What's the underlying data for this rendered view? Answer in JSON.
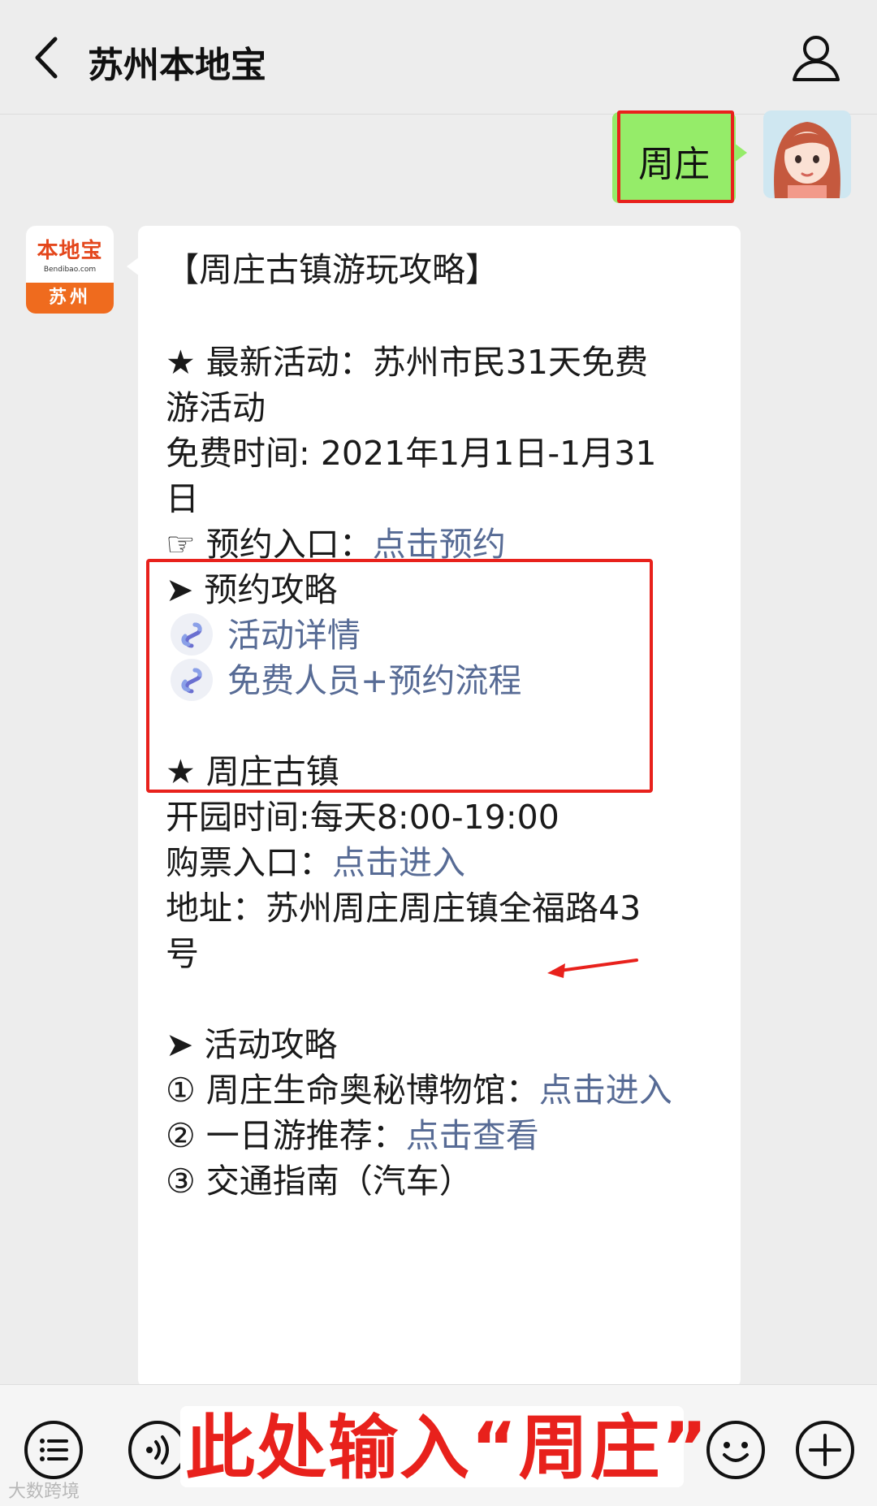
{
  "header": {
    "title": "苏州本地宝"
  },
  "outgoing": {
    "text": "周庄"
  },
  "bot": {
    "avatar_brand": "本地宝",
    "avatar_domain": "Bendibao.com",
    "avatar_city": "苏州"
  },
  "message": {
    "title": "【周庄古镇游玩攻略】",
    "s1_heading": "★ 最新活动：苏州市民31天免费",
    "s1_heading_cont": "游活动",
    "s1_time": "免费时间: 2021年1月1日-1月31",
    "s1_time_cont": "日",
    "reserve_label": "☞ 预约入口：",
    "reserve_link": "点击预约",
    "guide_heading": "➤ 预约攻略",
    "mp_link_1": "活动详情",
    "mp_link_2": "免费人员+预约流程",
    "s2_heading": "★ 周庄古镇",
    "s2_hours": "开园时间:每天8:00-19:00",
    "ticket_label": "购票入口：",
    "ticket_link": "点击进入",
    "address": "地址：苏州周庄周庄镇全福路43",
    "address_cont": "号",
    "s3_heading": "➤ 活动攻略",
    "item1_label": "① 周庄生命奥秘博物馆：",
    "item1_link": "点击进入",
    "item2_label": "② 一日游推荐：",
    "item2_link": "点击查看",
    "item3_label": "③ 交通指南（汽车）"
  },
  "annotation": {
    "overlay_text": "此处输入“周庄”"
  },
  "watermark": "大数跨境",
  "colors": {
    "accent_red": "#e8211c",
    "link": "#576b95",
    "bubble_out": "#95ec69",
    "brand_orange": "#ef6b1e"
  }
}
